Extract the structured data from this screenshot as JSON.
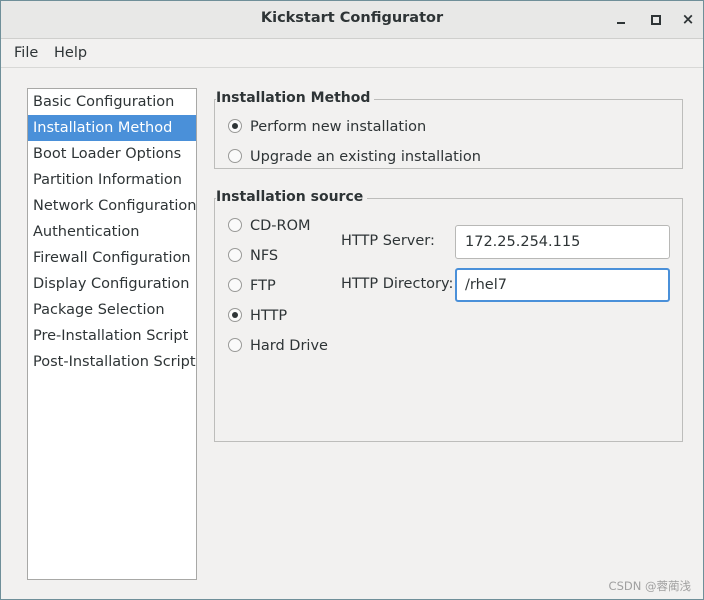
{
  "window": {
    "title": "Kickstart Configurator",
    "controls": {
      "minimize": "minimize-icon",
      "maximize": "maximize-icon",
      "close": "×"
    }
  },
  "menu": [
    {
      "label": "File"
    },
    {
      "label": "Help"
    }
  ],
  "sidebar": {
    "selected_index": 1,
    "items": [
      {
        "label": "Basic Configuration"
      },
      {
        "label": "Installation Method"
      },
      {
        "label": "Boot Loader Options"
      },
      {
        "label": "Partition Information"
      },
      {
        "label": "Network Configuration"
      },
      {
        "label": "Authentication"
      },
      {
        "label": "Firewall Configuration"
      },
      {
        "label": "Display Configuration"
      },
      {
        "label": "Package Selection"
      },
      {
        "label": "Pre-Installation Script"
      },
      {
        "label": "Post-Installation Script"
      }
    ]
  },
  "installation_method": {
    "title": "Installation Method",
    "options": [
      {
        "label": "Perform new installation",
        "checked": true
      },
      {
        "label": "Upgrade an existing installation",
        "checked": false
      }
    ]
  },
  "installation_source": {
    "title": "Installation source",
    "options": [
      {
        "label": "CD-ROM",
        "checked": false
      },
      {
        "label": "NFS",
        "checked": false
      },
      {
        "label": "FTP",
        "checked": false
      },
      {
        "label": "HTTP",
        "checked": true
      },
      {
        "label": "Hard Drive",
        "checked": false
      }
    ],
    "http_server": {
      "label": "HTTP Server:",
      "value": "172.25.254.115"
    },
    "http_directory": {
      "label": "HTTP Directory:",
      "value": "/rhel7"
    }
  },
  "watermark": "CSDN @蓉蔺浅"
}
